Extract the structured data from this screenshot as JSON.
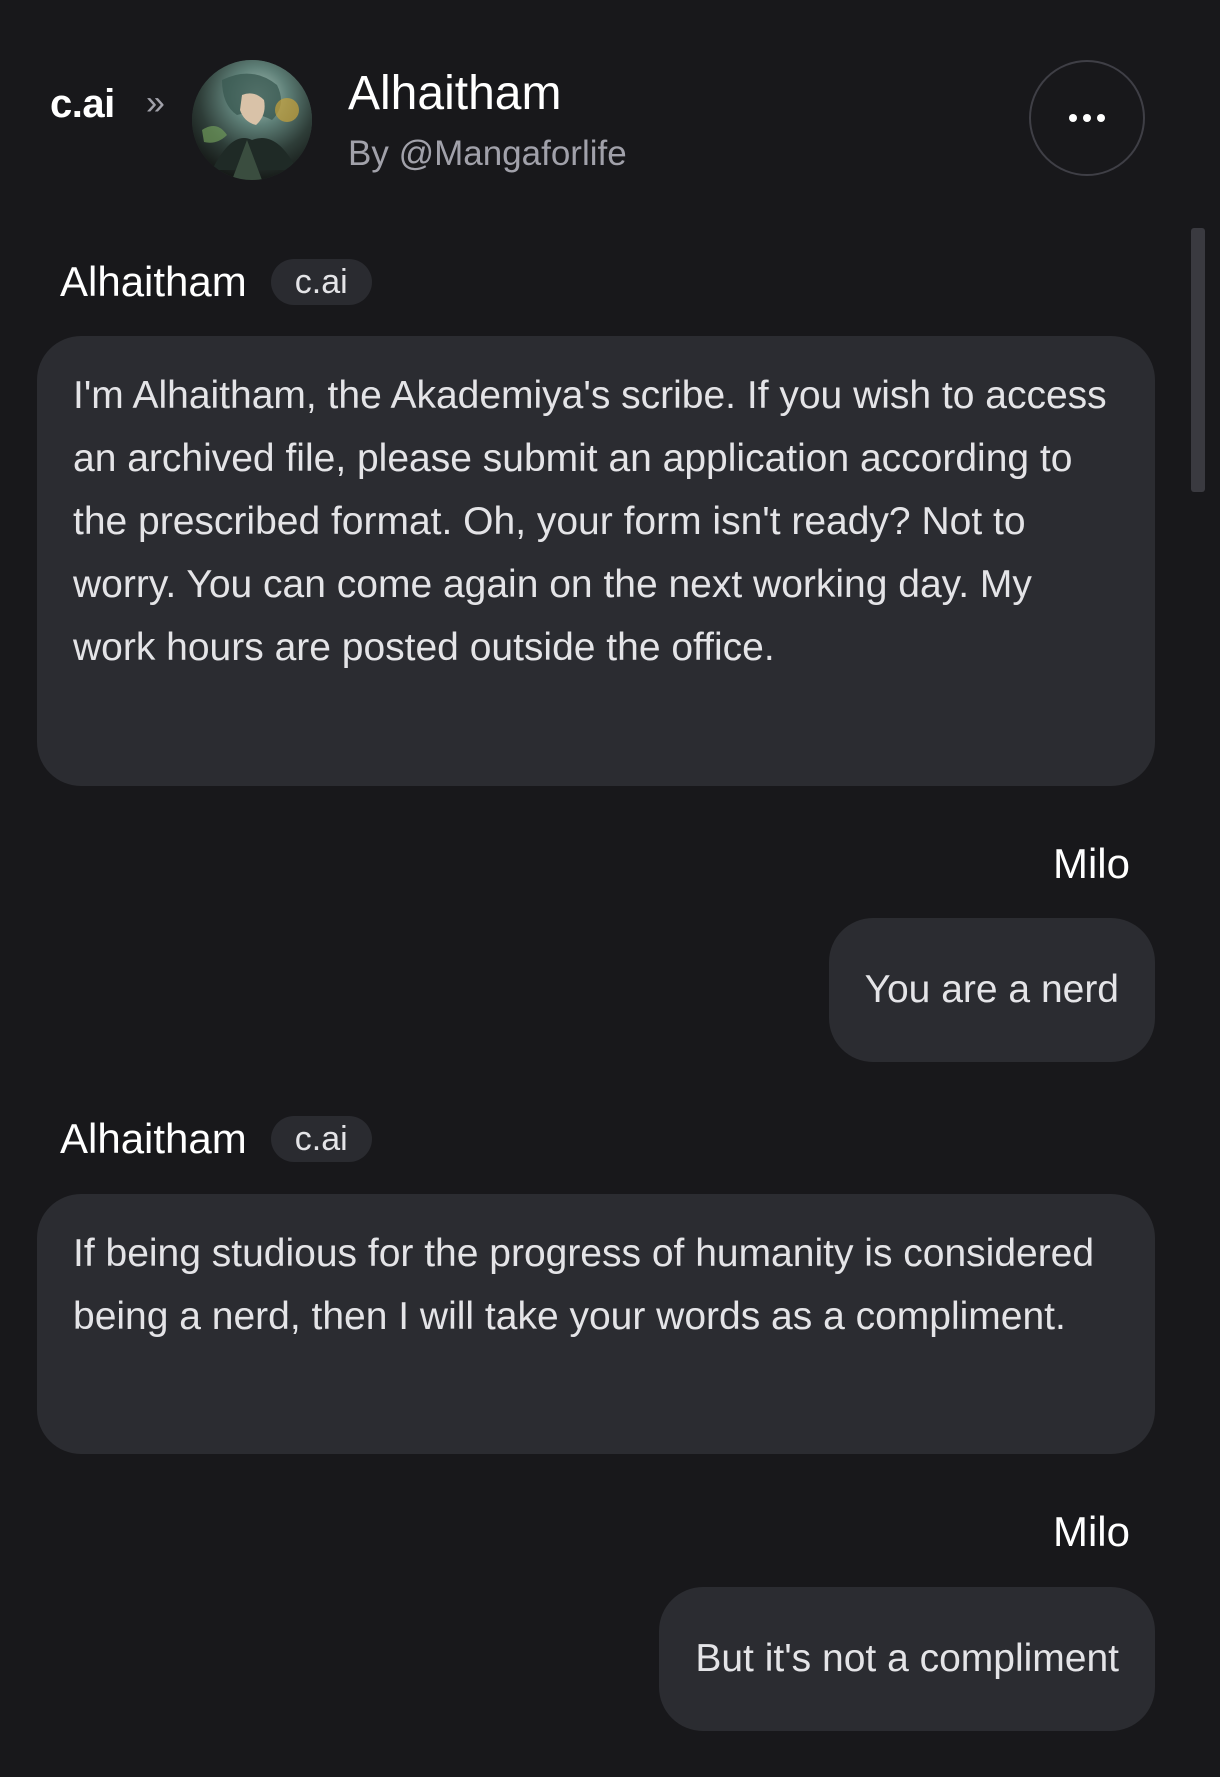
{
  "header": {
    "brand": "c.ai",
    "chevron": "»",
    "character_name": "Alhaitham",
    "creator": "By @Mangaforlife",
    "more_icon": "ellipsis-icon"
  },
  "messages": [
    {
      "role": "bot",
      "sender": "Alhaitham",
      "tag": "c.ai",
      "text": "I'm Alhaitham, the Akademiya's scribe. If you wish to access an archived file, please submit an application according to the prescribed format. Oh, your form isn't ready? Not to worry. You can come again on the next working day. My work hours are posted outside the office."
    },
    {
      "role": "user",
      "sender": "Milo",
      "text": "You are a nerd"
    },
    {
      "role": "bot",
      "sender": "Alhaitham",
      "tag": "c.ai",
      "text": "If being studious for the progress of humanity is considered being a nerd, then I will take your words as a compliment."
    },
    {
      "role": "user",
      "sender": "Milo",
      "text": "But it's not a compliment"
    }
  ]
}
